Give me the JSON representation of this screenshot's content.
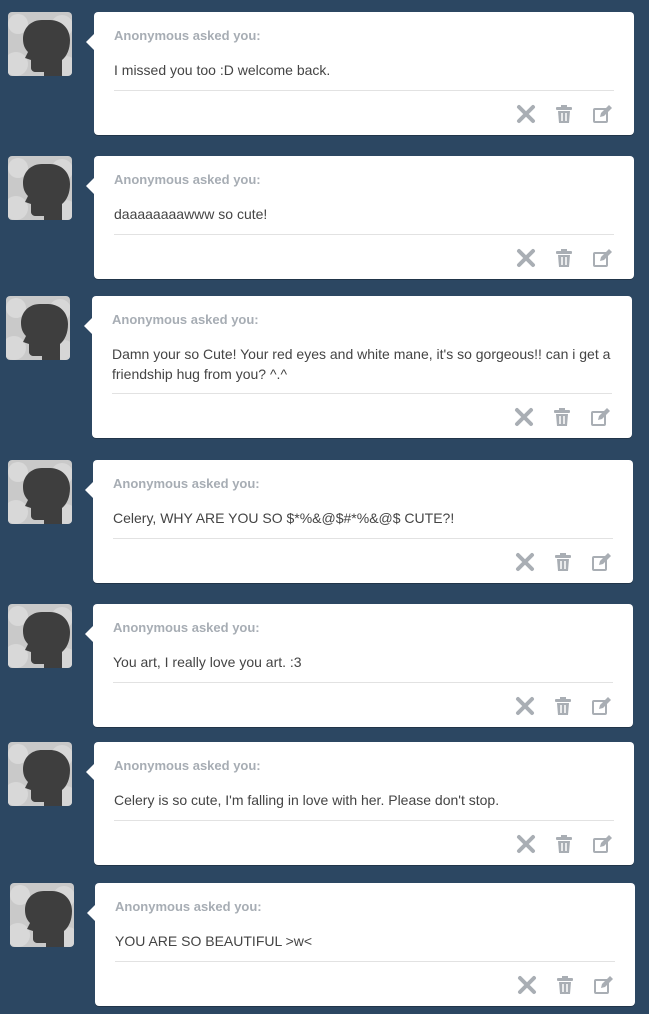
{
  "asks": [
    {
      "asker": "Anonymous asked you:",
      "question": "I missed you too :D welcome back."
    },
    {
      "asker": "Anonymous asked you:",
      "question": "daaaaaaaawww so cute!"
    },
    {
      "asker": "Anonymous asked you:",
      "question": "Damn your so Cute! Your red eyes and white mane, it's so gorgeous!! can i get a friendship hug from you? ^.^"
    },
    {
      "asker": "Anonymous asked you:",
      "question": "Celery, WHY ARE YOU SO $*%&@$#*%&@$ CUTE?!"
    },
    {
      "asker": "Anonymous asked you:",
      "question": "You art, I really love you art. :3"
    },
    {
      "asker": "Anonymous asked you:",
      "question": "Celery is so cute, I'm falling in love with her. Please don't stop."
    },
    {
      "asker": "Anonymous asked you:",
      "question": "YOU ARE SO BEAUTIFUL >w<"
    }
  ],
  "icons": {
    "delete": "close-icon",
    "trash": "trash-icon",
    "edit": "edit-icon"
  },
  "colors": {
    "background": "#2c4762",
    "card": "#ffffff",
    "asker_text": "#a7adb4",
    "question_text": "#444444",
    "icon": "#a9aeb4"
  }
}
